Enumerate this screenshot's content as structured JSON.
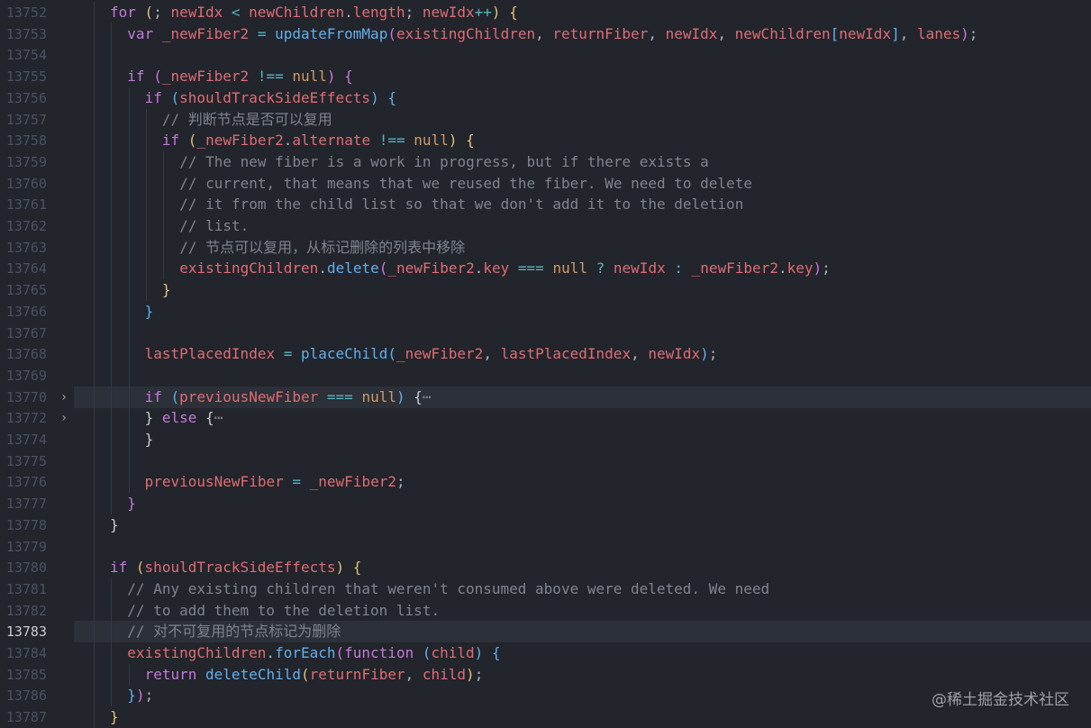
{
  "editor": {
    "current_line": "13783",
    "lines": [
      {
        "num": "13752",
        "indent": 2,
        "tokens": [
          [
            "k",
            "for"
          ],
          [
            "p",
            " "
          ],
          [
            "b1",
            "("
          ],
          [
            "p",
            "; "
          ],
          [
            "v",
            "newIdx"
          ],
          [
            "p",
            " "
          ],
          [
            "o",
            "<"
          ],
          [
            "p",
            " "
          ],
          [
            "v",
            "newChildren"
          ],
          [
            "dot",
            "."
          ],
          [
            "v",
            "length"
          ],
          [
            "p",
            "; "
          ],
          [
            "v",
            "newIdx"
          ],
          [
            "o",
            "++"
          ],
          [
            "b1",
            ")"
          ],
          [
            "p",
            " "
          ],
          [
            "b1",
            "{"
          ]
        ]
      },
      {
        "num": "13753",
        "indent": 3,
        "tokens": [
          [
            "k",
            "var"
          ],
          [
            "p",
            " "
          ],
          [
            "v",
            "_newFiber2"
          ],
          [
            "p",
            " "
          ],
          [
            "o",
            "="
          ],
          [
            "p",
            " "
          ],
          [
            "f",
            "updateFromMap"
          ],
          [
            "b2",
            "("
          ],
          [
            "v",
            "existingChildren"
          ],
          [
            "p",
            ", "
          ],
          [
            "v",
            "returnFiber"
          ],
          [
            "p",
            ", "
          ],
          [
            "v",
            "newIdx"
          ],
          [
            "p",
            ", "
          ],
          [
            "v",
            "newChildren"
          ],
          [
            "b3",
            "["
          ],
          [
            "v",
            "newIdx"
          ],
          [
            "b3",
            "]"
          ],
          [
            "p",
            ", "
          ],
          [
            "v",
            "lanes"
          ],
          [
            "b2",
            ")"
          ],
          [
            "p",
            ";"
          ]
        ]
      },
      {
        "num": "13754",
        "indent": 3,
        "tokens": []
      },
      {
        "num": "13755",
        "indent": 3,
        "tokens": [
          [
            "k",
            "if"
          ],
          [
            "p",
            " "
          ],
          [
            "b2",
            "("
          ],
          [
            "v",
            "_newFiber2"
          ],
          [
            "p",
            " "
          ],
          [
            "o",
            "!=="
          ],
          [
            "p",
            " "
          ],
          [
            "n",
            "null"
          ],
          [
            "b2",
            ")"
          ],
          [
            "p",
            " "
          ],
          [
            "b2",
            "{"
          ]
        ]
      },
      {
        "num": "13756",
        "indent": 4,
        "tokens": [
          [
            "k",
            "if"
          ],
          [
            "p",
            " "
          ],
          [
            "b3",
            "("
          ],
          [
            "v",
            "shouldTrackSideEffects"
          ],
          [
            "b3",
            ")"
          ],
          [
            "p",
            " "
          ],
          [
            "b3",
            "{"
          ]
        ]
      },
      {
        "num": "13757",
        "indent": 5,
        "tokens": [
          [
            "c",
            "// 判断节点是否可以复用"
          ]
        ]
      },
      {
        "num": "13758",
        "indent": 5,
        "tokens": [
          [
            "k",
            "if"
          ],
          [
            "p",
            " "
          ],
          [
            "b1",
            "("
          ],
          [
            "v",
            "_newFiber2"
          ],
          [
            "dot",
            "."
          ],
          [
            "v",
            "alternate"
          ],
          [
            "p",
            " "
          ],
          [
            "o",
            "!=="
          ],
          [
            "p",
            " "
          ],
          [
            "n",
            "null"
          ],
          [
            "b1",
            ")"
          ],
          [
            "p",
            " "
          ],
          [
            "b1",
            "{"
          ]
        ]
      },
      {
        "num": "13759",
        "indent": 6,
        "tokens": [
          [
            "c",
            "// The new fiber is a work in progress, but if there exists a"
          ]
        ]
      },
      {
        "num": "13760",
        "indent": 6,
        "tokens": [
          [
            "c",
            "// current, that means that we reused the fiber. We need to delete"
          ]
        ]
      },
      {
        "num": "13761",
        "indent": 6,
        "tokens": [
          [
            "c",
            "// it from the child list so that we don't add it to the deletion"
          ]
        ]
      },
      {
        "num": "13762",
        "indent": 6,
        "tokens": [
          [
            "c",
            "// list."
          ]
        ]
      },
      {
        "num": "13763",
        "indent": 6,
        "tokens": [
          [
            "c",
            "// 节点可以复用，从标记删除的列表中移除"
          ]
        ]
      },
      {
        "num": "13764",
        "indent": 6,
        "tokens": [
          [
            "v",
            "existingChildren"
          ],
          [
            "dot",
            "."
          ],
          [
            "f",
            "delete"
          ],
          [
            "b2",
            "("
          ],
          [
            "v",
            "_newFiber2"
          ],
          [
            "dot",
            "."
          ],
          [
            "v",
            "key"
          ],
          [
            "p",
            " "
          ],
          [
            "o",
            "==="
          ],
          [
            "p",
            " "
          ],
          [
            "n",
            "null"
          ],
          [
            "p",
            " "
          ],
          [
            "o",
            "?"
          ],
          [
            "p",
            " "
          ],
          [
            "v",
            "newIdx"
          ],
          [
            "p",
            " "
          ],
          [
            "o",
            ":"
          ],
          [
            "p",
            " "
          ],
          [
            "v",
            "_newFiber2"
          ],
          [
            "dot",
            "."
          ],
          [
            "v",
            "key"
          ],
          [
            "b2",
            ")"
          ],
          [
            "p",
            ";"
          ]
        ]
      },
      {
        "num": "13765",
        "indent": 5,
        "tokens": [
          [
            "b1",
            "}"
          ]
        ]
      },
      {
        "num": "13766",
        "indent": 4,
        "tokens": [
          [
            "b3",
            "}"
          ]
        ]
      },
      {
        "num": "13767",
        "indent": 4,
        "tokens": []
      },
      {
        "num": "13768",
        "indent": 4,
        "tokens": [
          [
            "v",
            "lastPlacedIndex"
          ],
          [
            "p",
            " "
          ],
          [
            "o",
            "="
          ],
          [
            "p",
            " "
          ],
          [
            "f",
            "placeChild"
          ],
          [
            "b3",
            "("
          ],
          [
            "v",
            "_newFiber2"
          ],
          [
            "p",
            ", "
          ],
          [
            "v",
            "lastPlacedIndex"
          ],
          [
            "p",
            ", "
          ],
          [
            "v",
            "newIdx"
          ],
          [
            "b3",
            ")"
          ],
          [
            "p",
            ";"
          ]
        ]
      },
      {
        "num": "13769",
        "indent": 4,
        "tokens": []
      },
      {
        "num": "13770",
        "indent": 4,
        "fold": "›",
        "hl": true,
        "tokens": [
          [
            "k",
            "if"
          ],
          [
            "p",
            " "
          ],
          [
            "b3",
            "("
          ],
          [
            "v",
            "previousNewFiber"
          ],
          [
            "p",
            " "
          ],
          [
            "o",
            "==="
          ],
          [
            "p",
            " "
          ],
          [
            "n",
            "null"
          ],
          [
            "b3",
            ")"
          ],
          [
            "p",
            " "
          ],
          [
            "fe",
            "{"
          ],
          [
            "c",
            "⋯"
          ]
        ]
      },
      {
        "num": "13772",
        "indent": 4,
        "fold": "›",
        "tokens": [
          [
            "fe",
            "}"
          ],
          [
            "p",
            " "
          ],
          [
            "k",
            "else"
          ],
          [
            "p",
            " "
          ],
          [
            "fe",
            "{"
          ],
          [
            "c",
            "⋯"
          ]
        ]
      },
      {
        "num": "13774",
        "indent": 4,
        "tokens": [
          [
            "fe",
            "}"
          ]
        ]
      },
      {
        "num": "13775",
        "indent": 4,
        "tokens": []
      },
      {
        "num": "13776",
        "indent": 4,
        "tokens": [
          [
            "v",
            "previousNewFiber"
          ],
          [
            "p",
            " "
          ],
          [
            "o",
            "="
          ],
          [
            "p",
            " "
          ],
          [
            "v",
            "_newFiber2"
          ],
          [
            "p",
            ";"
          ]
        ]
      },
      {
        "num": "13777",
        "indent": 3,
        "tokens": [
          [
            "b2",
            "}"
          ]
        ]
      },
      {
        "num": "13778",
        "indent": 2,
        "tokens": [
          [
            "fe",
            "}"
          ]
        ]
      },
      {
        "num": "13779",
        "indent": 2,
        "tokens": []
      },
      {
        "num": "13780",
        "indent": 2,
        "tokens": [
          [
            "k",
            "if"
          ],
          [
            "p",
            " "
          ],
          [
            "b1",
            "("
          ],
          [
            "v",
            "shouldTrackSideEffects"
          ],
          [
            "b1",
            ")"
          ],
          [
            "p",
            " "
          ],
          [
            "b1",
            "{"
          ]
        ]
      },
      {
        "num": "13781",
        "indent": 3,
        "tokens": [
          [
            "c",
            "// Any existing children that weren't consumed above were deleted. We need"
          ]
        ]
      },
      {
        "num": "13782",
        "indent": 3,
        "tokens": [
          [
            "c",
            "// to add them to the deletion list."
          ]
        ]
      },
      {
        "num": "13783",
        "indent": 3,
        "hl": true,
        "tokens": [
          [
            "c",
            "// 对不可复用的节点标记为删除"
          ]
        ]
      },
      {
        "num": "13784",
        "indent": 3,
        "tokens": [
          [
            "v",
            "existingChildren"
          ],
          [
            "dot",
            "."
          ],
          [
            "f",
            "forEach"
          ],
          [
            "b2",
            "("
          ],
          [
            "k",
            "function"
          ],
          [
            "p",
            " "
          ],
          [
            "b3",
            "("
          ],
          [
            "v",
            "child"
          ],
          [
            "b3",
            ")"
          ],
          [
            "p",
            " "
          ],
          [
            "b3",
            "{"
          ]
        ]
      },
      {
        "num": "13785",
        "indent": 4,
        "tokens": [
          [
            "k",
            "return"
          ],
          [
            "p",
            " "
          ],
          [
            "f",
            "deleteChild"
          ],
          [
            "b1",
            "("
          ],
          [
            "v",
            "returnFiber"
          ],
          [
            "p",
            ", "
          ],
          [
            "v",
            "child"
          ],
          [
            "b1",
            ")"
          ],
          [
            "p",
            ";"
          ]
        ]
      },
      {
        "num": "13786",
        "indent": 3,
        "tokens": [
          [
            "b3",
            "}"
          ],
          [
            "b2",
            ")"
          ],
          [
            "p",
            ";"
          ]
        ]
      },
      {
        "num": "13787",
        "indent": 2,
        "tokens": [
          [
            "b1",
            "}"
          ]
        ]
      }
    ]
  },
  "watermark": "@稀土掘金技术社区"
}
